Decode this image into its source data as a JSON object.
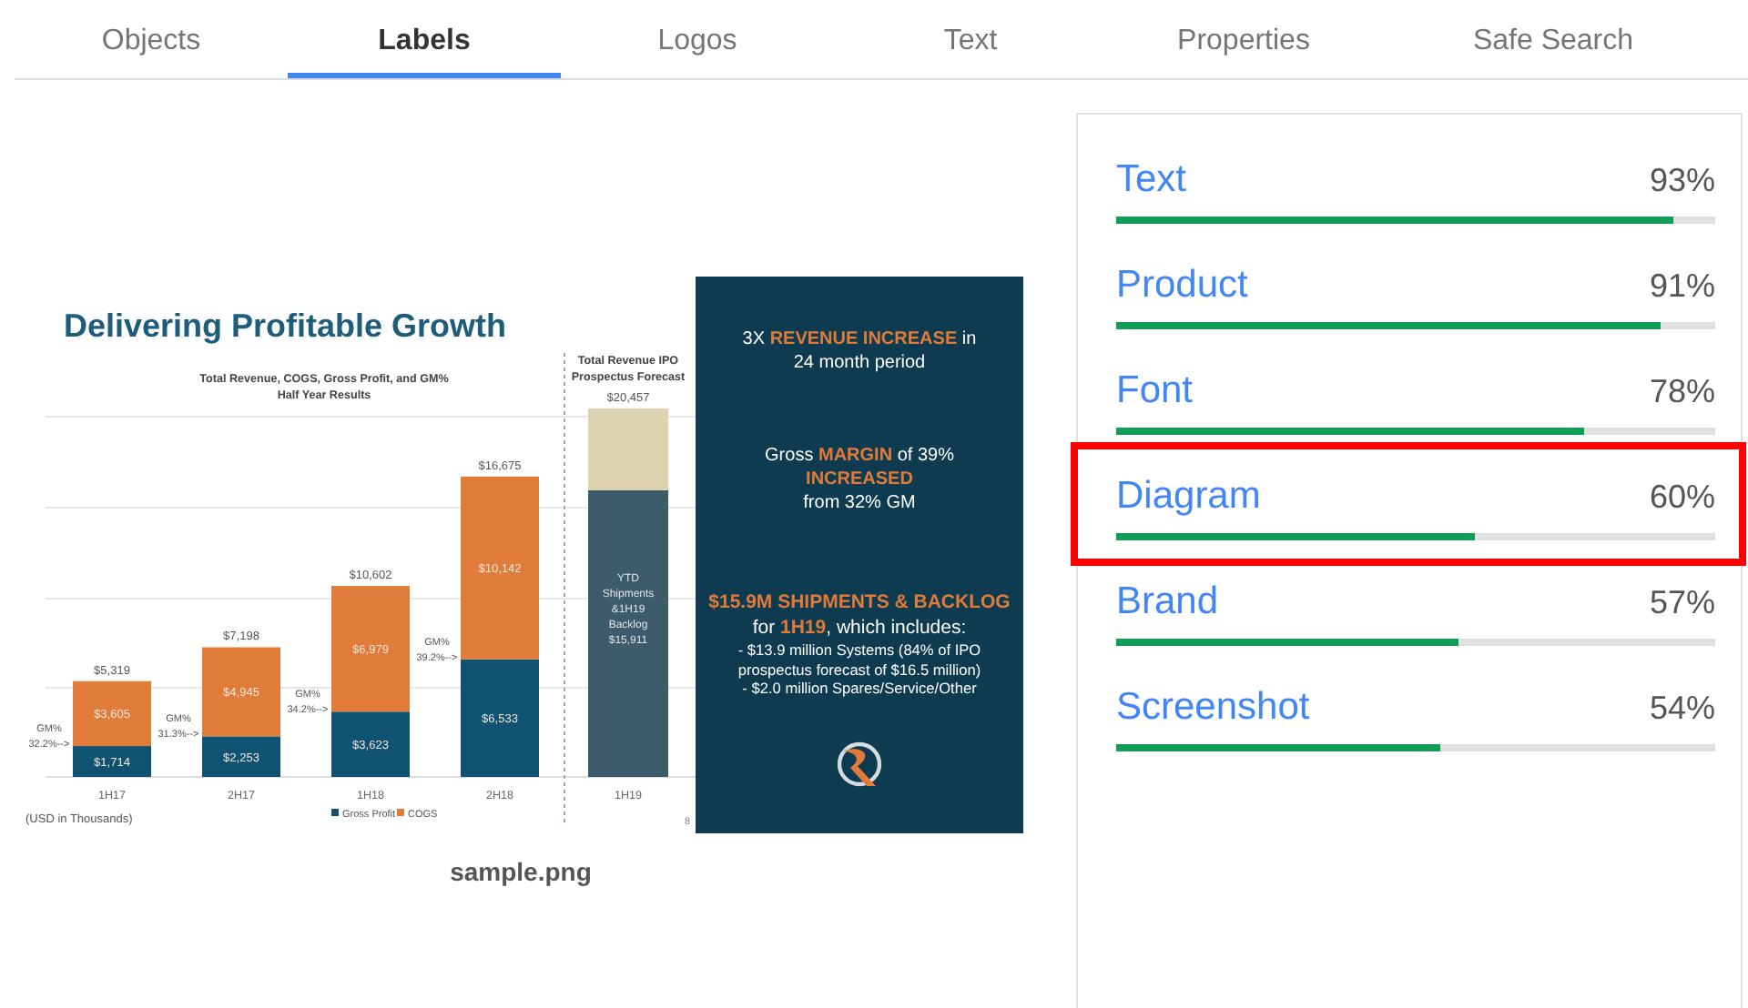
{
  "tabs": [
    {
      "label": "Objects",
      "selected": false
    },
    {
      "label": "Labels",
      "selected": true
    },
    {
      "label": "Logos",
      "selected": false
    },
    {
      "label": "Text",
      "selected": false
    },
    {
      "label": "Properties",
      "selected": false
    },
    {
      "label": "Safe Search",
      "selected": false
    }
  ],
  "image": {
    "filename": "sample.png",
    "slide": {
      "title": "Delivering Profitable Growth",
      "page_number": "8",
      "note": "(USD in Thousands)",
      "chart_data": {
        "type": "bar",
        "stacked": true,
        "title": "Total Revenue, COGS, Gross Profit, and GM%\nHalf Year Results",
        "legend": "bottom",
        "categories": [
          "1H17",
          "2H17",
          "1H18",
          "2H18"
        ],
        "series": [
          {
            "name": "Gross Profit",
            "color": "#0f5272",
            "values": [
              1714,
              2253,
              3623,
              6533
            ],
            "value_labels": [
              "$1,714",
              "$2,253",
              "$3,623",
              "$6,533"
            ]
          },
          {
            "name": "COGS",
            "color": "#e07b3a",
            "values": [
              3605,
              4945,
              6979,
              10142
            ],
            "value_labels": [
              "$3,605",
              "$4,945",
              "$6,979",
              "$10,142"
            ]
          }
        ],
        "annotations": [
          {
            "x": "1H17",
            "y": 5319,
            "text": "$5,319"
          },
          {
            "x": "2H17",
            "y": 7198,
            "text": "$7,198"
          },
          {
            "x": "1H18",
            "y": 10602,
            "text": "$10,602"
          },
          {
            "x": "2H18",
            "y": 16675,
            "text": "$16,675"
          }
        ]
      },
      "margin_labels": [
        "GM%\n32.2%-->",
        "GM%\n31.3%-->",
        "GM%\n34.2%-->",
        "GM%\n39.2%-->"
      ],
      "forecast": {
        "chart_data": {
          "type": "bar",
          "stacked": true,
          "title": "Total Revenue IPO\nProspectus Forecast",
          "categories": [
            "1H19"
          ],
          "series": [
            {
              "color": "#3e5b6c",
              "values": [
                15911
              ],
              "value_labels": [
                "YTD\nShipments\n&1H19\nBacklog\n$15,911"
              ]
            },
            {
              "color": "#ddd3b0",
              "values": [
                4546
              ],
              "value_labels": [
                null
              ]
            }
          ],
          "annotations": [
            {
              "x": "1H19",
              "y": 20457,
              "text": "$20,457"
            }
          ]
        }
      },
      "highlights": [
        {
          "kind": "lead",
          "text": "3X **REVENUE INCREASE** in\n24 month period"
        },
        {
          "kind": "lead",
          "text": "Gross **MARGIN** of 39%\n**INCREASED**\nfrom 32% GM"
        },
        {
          "kind": "headline",
          "text": "**$15.9M SHIPMENTS & BACKLOG**\nfor **1H19**, which includes:"
        },
        {
          "kind": "detail",
          "text": "- $13.9 million Systems (84% of IPO\nprospectus forecast of $16.5 million)\n- $2.0 million Spares/Service/Other"
        }
      ]
    }
  },
  "labels": [
    {
      "label": "Text",
      "score": "93%",
      "level": 0.93,
      "highlighted": false
    },
    {
      "label": "Product",
      "score": "91%",
      "level": 0.91,
      "highlighted": false
    },
    {
      "label": "Font",
      "score": "78%",
      "level": 0.78,
      "highlighted": false
    },
    {
      "label": "Diagram",
      "score": "60%",
      "level": 0.6,
      "highlighted": true
    },
    {
      "label": "Brand",
      "score": "57%",
      "level": 0.57,
      "highlighted": false
    },
    {
      "label": "Screenshot",
      "score": "54%",
      "level": 0.54,
      "highlighted": false
    }
  ]
}
